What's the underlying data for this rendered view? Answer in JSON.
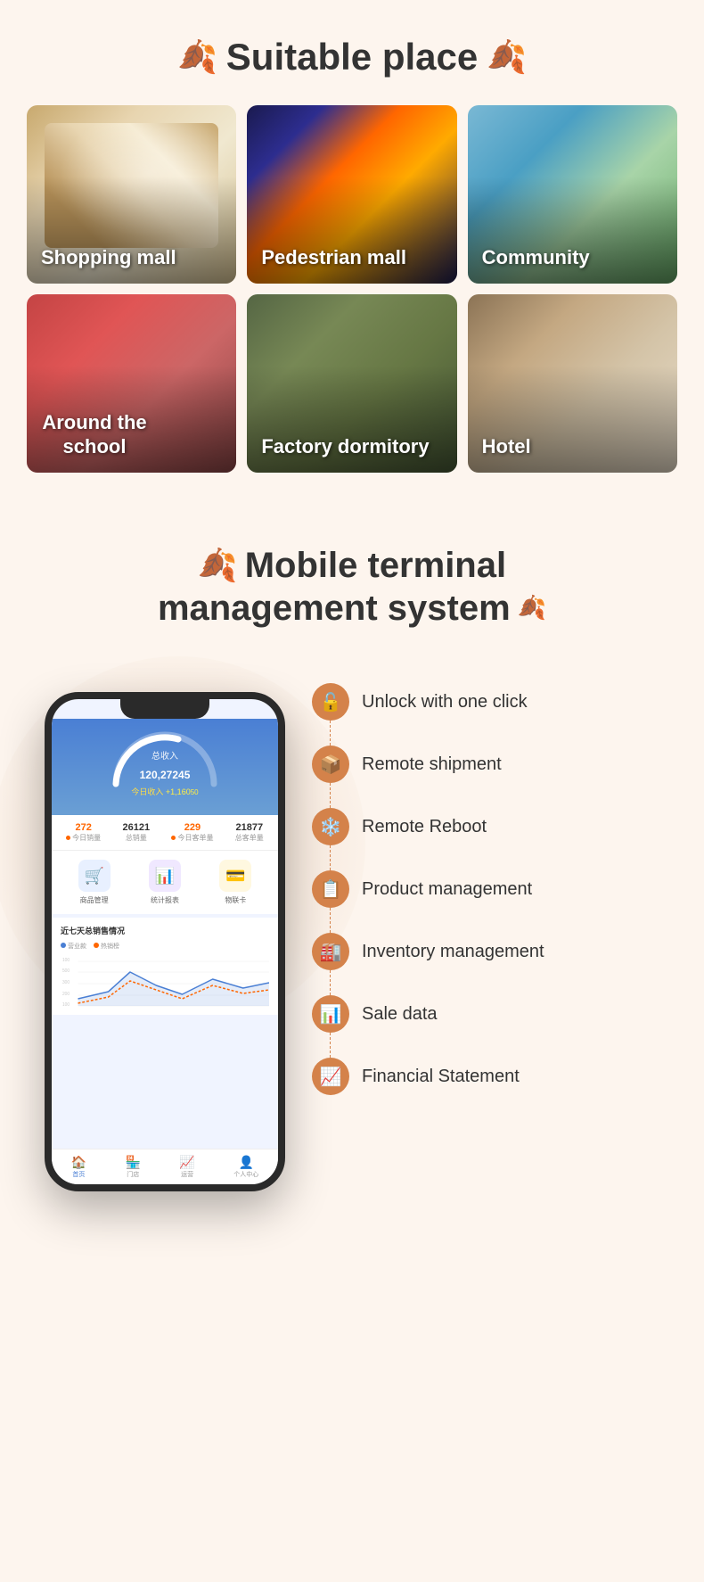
{
  "suitable": {
    "title": "Suitable place",
    "leaf_left": "🍂",
    "leaf_right": "🍂",
    "grid_items": [
      {
        "id": "shopping-mall",
        "label": "Shopping mall",
        "bg_class": "bg-shopping"
      },
      {
        "id": "pedestrian-mall",
        "label": "Pedestrian mall",
        "bg_class": "bg-pedestrian"
      },
      {
        "id": "community",
        "label": "Community",
        "bg_class": "bg-community"
      },
      {
        "id": "around-school",
        "label": "Around the school",
        "bg_class": "bg-school"
      },
      {
        "id": "factory-dormitory",
        "label": "Factory dormitory",
        "bg_class": "bg-factory"
      },
      {
        "id": "hotel",
        "label": "Hotel",
        "bg_class": "bg-hotel"
      }
    ]
  },
  "mobile": {
    "title_line1": "Mobile terminal",
    "title_line2": "management system",
    "leaf_icon": "🍂",
    "phone": {
      "revenue_label": "总收入",
      "revenue_amount": "120,272",
      "revenue_decimal": "45",
      "today_label": "今日收入",
      "today_amount": "+1,160",
      "today_decimal": "50",
      "stats": [
        {
          "num": "272",
          "dot": true,
          "color": "orange",
          "label": "今日销量"
        },
        {
          "num": "26121",
          "dot": false,
          "color": "black",
          "label": "总销量"
        },
        {
          "num": "229",
          "dot": true,
          "color": "orange",
          "label": "今日客单量"
        },
        {
          "num": "21877",
          "dot": false,
          "color": "black",
          "label": "总客单量"
        }
      ],
      "icon_items": [
        {
          "label": "商品管理",
          "icon": "🛒",
          "class": "icon-blue"
        },
        {
          "label": "统计报表",
          "icon": "📊",
          "class": "icon-purple"
        },
        {
          "label": "物联卡",
          "icon": "💳",
          "class": "icon-yellow"
        }
      ],
      "chart_title": "近七天总销售情况",
      "chart_legend": [
        "营业款",
        "热销榜"
      ],
      "bottom_nav": [
        {
          "label": "首页",
          "icon": "🏠",
          "active": true
        },
        {
          "label": "门店",
          "icon": "🏪",
          "active": false
        },
        {
          "label": "运营",
          "icon": "📈",
          "active": false
        },
        {
          "label": "个人中心",
          "icon": "👤",
          "active": false
        }
      ]
    },
    "features": [
      {
        "id": "unlock",
        "icon": "🔓",
        "text": "Unlock with one click"
      },
      {
        "id": "remote-shipment",
        "icon": "📦",
        "text": "Remote shipment"
      },
      {
        "id": "remote-reboot",
        "icon": "❄️",
        "text": "Remote Reboot"
      },
      {
        "id": "product-management",
        "icon": "📋",
        "text": "Product management"
      },
      {
        "id": "inventory-management",
        "icon": "🏭",
        "text": "Inventory management"
      },
      {
        "id": "sale-data",
        "icon": "📊",
        "text": "Sale data"
      },
      {
        "id": "financial-statement",
        "icon": "📈",
        "text": "Financial Statement"
      }
    ]
  }
}
